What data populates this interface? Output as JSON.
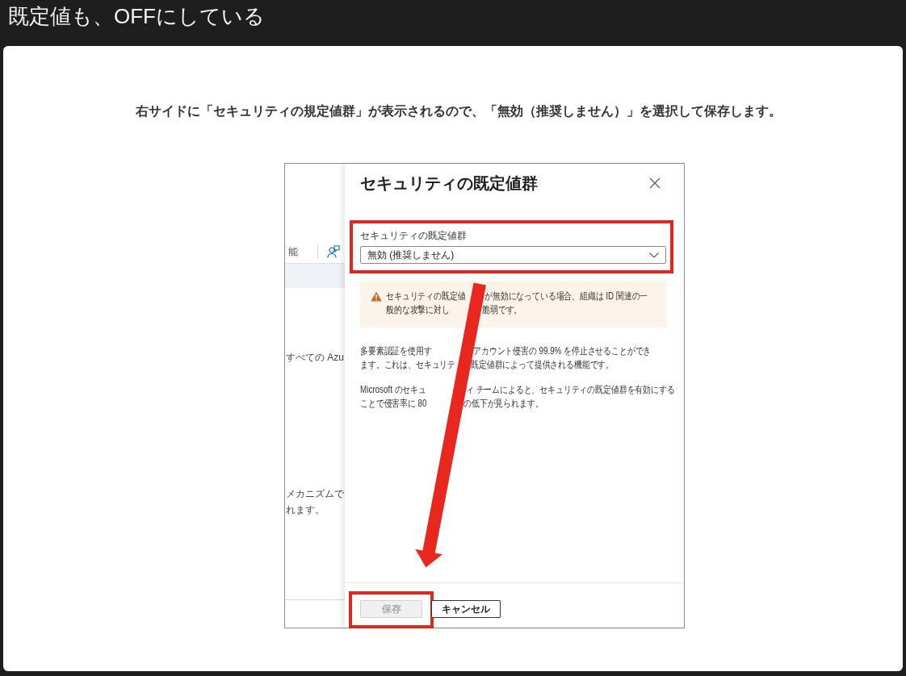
{
  "header": {
    "title": "既定値も、OFFにしている"
  },
  "instruction": "右サイドに「セキュリティの規定値群」が表示されるので、「無効（推奨しません）」を選択して保存します。",
  "screenshot": {
    "background_page": {
      "toolbar_label": "能",
      "texts": [
        "すべての Azu",
        "メカニズムで",
        "れます。"
      ]
    },
    "panel": {
      "title": "セキュリティの既定値群",
      "field": {
        "label": "セキュリティの既定値群",
        "value": "無効 (推奨しません)",
        "highlighted": true
      },
      "warning": {
        "lines": [
          [
            "セキュリティの既定値",
            "が無効になっている場合、組織は ID 関連の一"
          ],
          [
            "般的な攻撃に対し",
            "脆弱です。"
          ]
        ]
      },
      "paragraphs": [
        {
          "lines": [
            [
              "多要素認証を使用す",
              "アカウント侵害の 99.9% を停止させることができ"
            ],
            [
              "ます。これは、セキュリテ",
              "既定値群によって提供される機能です。"
            ]
          ]
        },
        {
          "lines": [
            [
              "Microsoft のセキュ",
              "ィ チームによると、セキュリティの既定値群を有効にする"
            ],
            [
              "ことで侵害率に 80",
              "の低下が見られます。"
            ]
          ]
        }
      ],
      "buttons": [
        {
          "label": "保存",
          "disabled": true,
          "highlighted": true
        },
        {
          "label": "キャンセル",
          "disabled": false,
          "highlighted": false
        }
      ]
    }
  }
}
